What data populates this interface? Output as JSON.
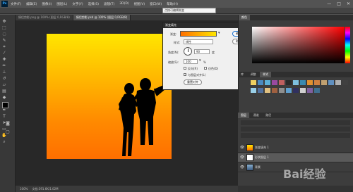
{
  "menubar": {
    "logo": "Ps",
    "items": [
      "文件(F)",
      "编辑(E)",
      "图像(I)",
      "图层(L)",
      "文字(Y)",
      "选择(S)",
      "滤镜(T)",
      "3D(D)",
      "视图(V)",
      "窗口(W)",
      "帮助(H)"
    ],
    "minimize": "—",
    "maximize": "□",
    "close": "✕"
  },
  "doctabs": [
    {
      "label": "情侣剪影.png @ 100% (图层 0,RGB/8)",
      "active": false
    },
    {
      "label": "情侣剪影.psd @ 100% (图层 0,RGB/8)",
      "active": true
    }
  ],
  "tooltip": "点按可编辑渐变",
  "dialog": {
    "title": "渐变填充",
    "gradient_label": "渐变:",
    "style_label": "样式:",
    "style_value": "线性",
    "angle_label": "角度(N):",
    "angle_value": "90",
    "angle_unit": "度",
    "scale_label": "缩放(S):",
    "scale_value": "100",
    "scale_unit": "%",
    "reverse_label": "反向(R)",
    "dither_label": "仿色(D)",
    "align_label": "与图层对齐(L)",
    "reset_label": "重置对齐",
    "ok_label": "确定",
    "cancel_label": "取消"
  },
  "rightpanel": {
    "color_tab": "颜色",
    "swatch_tabs": [
      "库",
      "调整",
      "样式"
    ],
    "layers_tabs": [
      "图层",
      "通道",
      "路径"
    ],
    "swatch_colors": [
      "#f0d060",
      "#4a8ac0",
      "#5cb0d8",
      "#9a4aa0",
      "#c06060",
      "#2a2a2a",
      "#7ec0e0",
      "#3a8ab0",
      "#e09030",
      "#d08040",
      "#c0a070",
      "#6090c0",
      "#b0b0b0",
      "#404040",
      "#9ad0e8",
      "#5070a0",
      "#e0c080",
      "#a06040",
      "#909090",
      "#60a0d0",
      "#303060",
      "#d0d0d0",
      "#8060a0",
      "#407090"
    ],
    "layers": [
      {
        "name": "渐变填充 1",
        "selected": false
      },
      {
        "name": "形状图层 1",
        "selected": true
      },
      {
        "name": "背景",
        "selected": false
      }
    ]
  },
  "statusbar": {
    "zoom": "100%",
    "doc": "文档:391.6K/1.02M"
  },
  "watermark": "Bai经验",
  "colors": {
    "gradient_start": "#ffe600",
    "gradient_end": "#ff6f00",
    "swatch_fg": "#000000",
    "swatch_bg": "#e8e8b0"
  }
}
